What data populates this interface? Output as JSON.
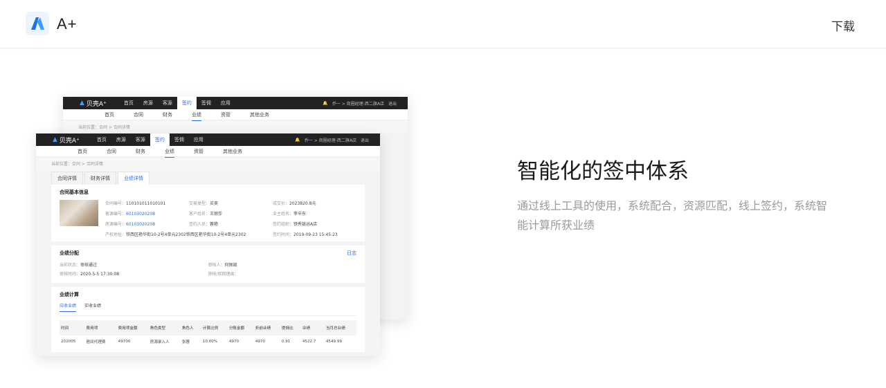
{
  "header": {
    "app_name": "A+",
    "download_label": "下载"
  },
  "feature": {
    "title": "智能化的签中体系",
    "description": "通过线上工具的使用，系统配合，资源匹配，线上签约，系统智能计算所获业绩"
  },
  "mockup": {
    "brand": "贝壳A⁺",
    "top_nav": [
      "首页",
      "房源",
      "客源",
      "签约",
      "签佣",
      "应用"
    ],
    "user_info": "乔一 > 商圈经理-西二旗A店",
    "logout": "退出",
    "sub_nav": [
      "首页",
      "合同",
      "财务",
      "业绩",
      "资管",
      "其他业务"
    ],
    "breadcrumb": "当前位置：合同 > 合同详情",
    "tabs": [
      "合同详情",
      "财务详情",
      "业绩详情"
    ],
    "basic_info": {
      "title": "合同基本信息",
      "fields": [
        {
          "k": "合同编号：",
          "v": "110101011010101"
        },
        {
          "k": "交易类型：",
          "v": "买卖"
        },
        {
          "k": "成交价：",
          "v": "2023820.8元"
        },
        {
          "k": "客源编号：",
          "v": "60103020208"
        },
        {
          "k": "客户姓名：",
          "v": "王丽莎"
        },
        {
          "k": "业主姓名：",
          "v": "李辛东"
        },
        {
          "k": "房源编号：",
          "v": "60103020208"
        },
        {
          "k": "签约人员：",
          "v": "蓉艳"
        },
        {
          "k": "签约组织：",
          "v": "铁秀链谷A店"
        },
        {
          "k": "产权地址：",
          "v": "铁西区艳华街10-2号4单元2302铁西区艳华街10-2号4单元2302"
        },
        {
          "k": "签约时间：",
          "v": "2019-09-23 15:45:23"
        }
      ]
    },
    "allocation": {
      "title": "业绩分配",
      "log_link": "日志",
      "status_k": "当前状态：",
      "status_v": "审核通过",
      "auditor_k": "审核人：",
      "auditor_v": "何佩斌",
      "time_k": "审核时间：",
      "time_v": "2020-5-5 17:30:08",
      "reason_k": "审核/驳回理由："
    },
    "calc": {
      "title": "业绩计算",
      "subtabs": [
        "应收业绩",
        "实收业绩"
      ],
      "columns": [
        "时间",
        "费用项",
        "费用项金额",
        "角色类型",
        "角色人",
        "计算比例",
        "分账金额",
        "折前业绩",
        "提佣比",
        "业绩",
        "当月总业绩"
      ],
      "rows": [
        [
          "202005",
          "居间代理费",
          "49700",
          "房源录入人",
          "张蓉",
          "10.00%",
          "4970",
          "4970",
          "0.91",
          "4522.7",
          "4549.99"
        ]
      ]
    }
  }
}
